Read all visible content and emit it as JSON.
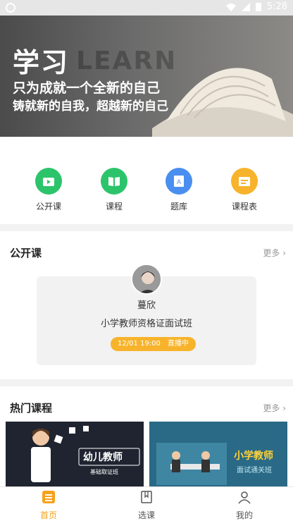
{
  "status_bar": {
    "time": "5:28"
  },
  "banner": {
    "title": "学习",
    "watermark": "LEARN",
    "line1": "只为成就一个全新的自己",
    "line2": "铸就新的自我，超越新的自己"
  },
  "nav": [
    {
      "label": "公开课",
      "icon": "tv-icon",
      "color": "#2cc46b"
    },
    {
      "label": "课程",
      "icon": "book-icon",
      "color": "#2cc46b"
    },
    {
      "label": "题库",
      "icon": "question-bank-icon",
      "color": "#4a8ff0"
    },
    {
      "label": "课程表",
      "icon": "schedule-icon",
      "color": "#f7b32b"
    }
  ],
  "open_class": {
    "title": "公开课",
    "more": "更多 ›",
    "teacher": "蔓欣",
    "course": "小学教师资格证面试班",
    "date": "12/01 19:00",
    "status": "直播中"
  },
  "hot": {
    "title": "热门课程",
    "more": "更多 ›",
    "items": [
      {
        "label": "幼儿教师",
        "sub": "基础取证班"
      },
      {
        "label": "小学教师",
        "sub": "面试通关班"
      }
    ]
  },
  "tabs": [
    {
      "label": "首页",
      "icon": "home-icon"
    },
    {
      "label": "选课",
      "icon": "course-select-icon"
    },
    {
      "label": "我的",
      "icon": "profile-icon"
    }
  ],
  "colors": {
    "accent": "#f7a21b",
    "green": "#2cc46b",
    "blue": "#4a8ff0"
  }
}
